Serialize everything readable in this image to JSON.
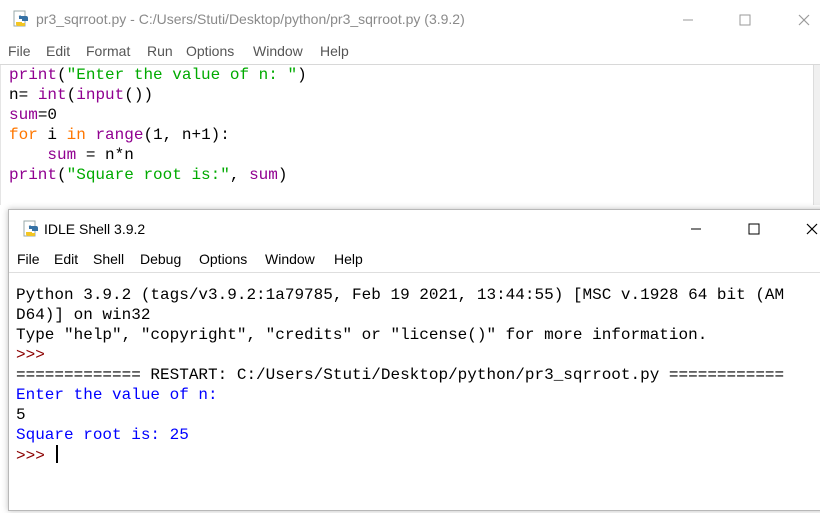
{
  "editor": {
    "title": "pr3_sqrroot.py - C:/Users/Stuti/Desktop/python/pr3_sqrroot.py (3.9.2)",
    "menu": [
      "File",
      "Edit",
      "Format",
      "Run",
      "Options",
      "Window",
      "Help"
    ],
    "code": [
      [
        {
          "t": "bi",
          "v": "print"
        },
        {
          "t": "nm",
          "v": "("
        },
        {
          "t": "st",
          "v": "\"Enter the value of n: \""
        },
        {
          "t": "nm",
          "v": ")"
        }
      ],
      [
        {
          "t": "nm",
          "v": "n= "
        },
        {
          "t": "bi",
          "v": "int"
        },
        {
          "t": "nm",
          "v": "("
        },
        {
          "t": "bi",
          "v": "input"
        },
        {
          "t": "nm",
          "v": "())"
        }
      ],
      [
        {
          "t": "bi",
          "v": "sum"
        },
        {
          "t": "nm",
          "v": "=0"
        }
      ],
      [
        {
          "t": "kw",
          "v": "for"
        },
        {
          "t": "nm",
          "v": " i "
        },
        {
          "t": "kw",
          "v": "in"
        },
        {
          "t": "nm",
          "v": " "
        },
        {
          "t": "bi",
          "v": "range"
        },
        {
          "t": "nm",
          "v": "(1, n+1):"
        }
      ],
      [
        {
          "t": "nm",
          "v": "    "
        },
        {
          "t": "bi",
          "v": "sum"
        },
        {
          "t": "nm",
          "v": " = n*n"
        }
      ],
      [
        {
          "t": "bi",
          "v": "print"
        },
        {
          "t": "nm",
          "v": "("
        },
        {
          "t": "st",
          "v": "\"Square root is:\""
        },
        {
          "t": "nm",
          "v": ", "
        },
        {
          "t": "bi",
          "v": "sum"
        },
        {
          "t": "nm",
          "v": ")"
        }
      ]
    ]
  },
  "shell": {
    "title": "IDLE Shell 3.9.2",
    "menu": [
      "File",
      "Edit",
      "Shell",
      "Debug",
      "Options",
      "Window",
      "Help"
    ],
    "lines": [
      {
        "text": "Python 3.9.2 (tags/v3.9.2:1a79785, Feb 19 2021, 13:44:55) [MSC v.1928 64 bit (AM",
        "style": "normal"
      },
      {
        "text": "D64)] on win32",
        "style": "normal"
      },
      {
        "text": "Type \"help\", \"copyright\", \"credits\" or \"license()\" for more information.",
        "style": "normal"
      },
      {
        "text": ">>> ",
        "style": "prompt"
      },
      {
        "text": "============= RESTART: C:/Users/Stuti/Desktop/python/pr3_sqrroot.py ============",
        "style": "normal"
      },
      {
        "text": "Enter the value of n: ",
        "style": "blue"
      },
      {
        "text": "5",
        "style": "normal"
      },
      {
        "text": "Square root is: 25",
        "style": "blue"
      },
      {
        "text": ">>> ",
        "style": "prompt-cursor"
      }
    ]
  },
  "colors": {
    "keyword": "#ff7700",
    "builtin": "#900090",
    "string": "#00aa00",
    "output": "#0000ff",
    "prompt": "#8b0000"
  }
}
